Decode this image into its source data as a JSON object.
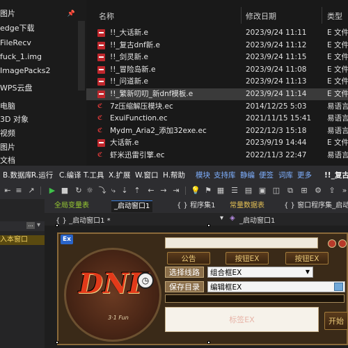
{
  "explorer": {
    "nav_items": [
      "图片",
      "edge下载",
      "FileRecv",
      "fuck_1.img",
      "ImagePacks2",
      "WPS云盘",
      "电脑",
      "3D 对象",
      "视频",
      "图片",
      "文档"
    ],
    "columns": {
      "name": "名称",
      "date": "修改日期",
      "type": "类型"
    },
    "files": [
      {
        "name": "!!_大话新.e",
        "date": "2023/9/24 11:11",
        "type": "E 文件",
        "icon": "e-file-icon",
        "selected": false
      },
      {
        "name": "!!_复古dnf新.e",
        "date": "2023/9/24 11:12",
        "type": "E 文件",
        "icon": "e-file-icon",
        "selected": false
      },
      {
        "name": "!!_剑灵新.e",
        "date": "2023/9/24 11:15",
        "type": "E 文件",
        "icon": "e-file-icon",
        "selected": false
      },
      {
        "name": "!!_冒险岛新.e",
        "date": "2023/9/24 11:08",
        "type": "E 文件",
        "icon": "e-file-icon",
        "selected": false
      },
      {
        "name": "!!_问道新.e",
        "date": "2023/9/24 11:13",
        "type": "E 文件",
        "icon": "e-file-icon",
        "selected": false
      },
      {
        "name": "!!_繁新叨叨_新dnf模板.e",
        "date": "2023/9/24 11:14",
        "type": "E 文件",
        "icon": "e-file-icon",
        "selected": true
      },
      {
        "name": "7z压缩解压模块.ec",
        "date": "2014/12/25 5:03",
        "type": "易语言",
        "icon": "ec-file-icon",
        "selected": false
      },
      {
        "name": "ExuiFunction.ec",
        "date": "2021/11/15 15:41",
        "type": "易语言",
        "icon": "ec-file-icon",
        "selected": false
      },
      {
        "name": "Mydm_Aria2_添加32exe.ec",
        "date": "2022/12/3 15:18",
        "type": "易语言",
        "icon": "ec-file-icon",
        "selected": false
      },
      {
        "name": "大话新.e",
        "date": "2023/9/19 14:44",
        "type": "E 文件",
        "icon": "e-file-icon",
        "selected": false
      },
      {
        "name": "虾米迅雷引擎.ec",
        "date": "2022/11/3 22:47",
        "type": "易语言",
        "icon": "ec-file-icon",
        "selected": false
      }
    ]
  },
  "ide": {
    "menus": [
      "B.数据库",
      "R.运行",
      "C.编译",
      "T.工具",
      "X.扩展",
      "W.窗口",
      "H.帮助"
    ],
    "plugin_menus": [
      "模块",
      "支持库",
      "静编",
      "便签",
      "词库",
      "更多"
    ],
    "title_fragment": "!!_复古",
    "tabs": [
      "全局变量表",
      "_启动窗口1",
      "{ } 程序集1",
      "常量数据表",
      "{ } 窗口程序集_启动"
    ],
    "path_left": "{ } _启动窗口1 *",
    "path_right": "_启动窗口1",
    "left_panel_item": "入本窗口",
    "more_label": "..."
  },
  "form": {
    "ex_badge": "Ex",
    "logo_text": "DNF",
    "logo_sub": "3·1 Fun",
    "buttons": {
      "notice": "公告",
      "btn1": "按钮EX",
      "btn2": "按钮EX",
      "start": "开始"
    },
    "labels": {
      "select_line": "选择线路",
      "save_dir": "保存目录"
    },
    "combo_value": "组合框EX",
    "edit_value": "编辑框EX",
    "label_box": "标签EX",
    "colors": {
      "gold": "#e8c777",
      "brown": "#3a2a18",
      "accent_blue": "#3c7fd8"
    }
  }
}
